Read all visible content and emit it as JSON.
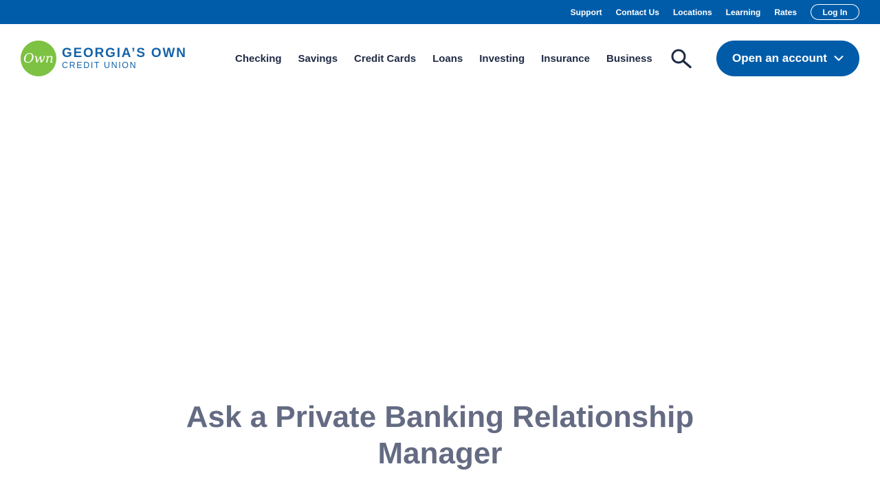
{
  "utility_nav": {
    "links": [
      "Support",
      "Contact Us",
      "Locations",
      "Learning",
      "Rates"
    ],
    "login_label": "Log In"
  },
  "logo": {
    "mark_text": "Own",
    "line1": "GEORGIA’S OWN",
    "line2": "CREDIT UNION"
  },
  "main_nav": {
    "items": [
      "Checking",
      "Savings",
      "Credit Cards",
      "Loans",
      "Investing",
      "Insurance",
      "Business"
    ],
    "search_icon": "search-icon",
    "cta_label": "Open an account",
    "cta_icon": "chevron-down-icon"
  },
  "hero": {
    "heading_line1": "Ask a Private Banking Relationship",
    "heading_line2": "Manager"
  },
  "colors": {
    "brand_blue": "#005ca9",
    "logo_green": "#7dc242",
    "heading_gray": "#646b83",
    "nav_text": "#1f2a44"
  }
}
